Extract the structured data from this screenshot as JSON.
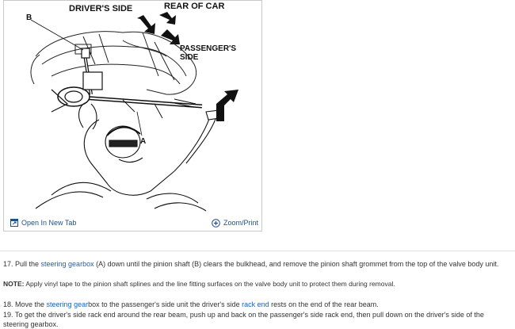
{
  "figure": {
    "labels": {
      "b": "B",
      "drivers_side": "DRIVER'S SIDE",
      "rear_of_car": "REAR OF CAR",
      "passengers_side_line1": "PASSENGER'S",
      "passengers_side_line2": "SIDE",
      "a": "A"
    },
    "toolbar": {
      "open_new_tab": "Open In New Tab",
      "zoom_print": "Zoom/Print"
    }
  },
  "steps": {
    "step17": {
      "prefix": "17. Pull the ",
      "link1": "steering gearbox",
      "rest": " (A) down until the pinion shaft (B) clears the bulkhead, and remove the pinion shaft grommet from the top of the valve body unit."
    },
    "note": {
      "label": "NOTE:",
      "text": " Apply vinyl tape to the pinion shaft splines and the line fitting surfaces on the valve body unit to protect them during removal."
    },
    "step18": {
      "prefix": "18. Move the ",
      "link1": "steering gear",
      "mid": "box to the passenger's side unit the driver's side ",
      "link2": "rack end",
      "rest": " rests on the end of the rear beam."
    },
    "step19": {
      "text": "19. To get the driver's side rack end around the rear beam, push up and back on the passenger's side rack end, then pull down on the driver's side of the steering gearbox."
    }
  },
  "colors": {
    "link": "#1a62b8",
    "toolbar_link": "#1d4f91"
  }
}
